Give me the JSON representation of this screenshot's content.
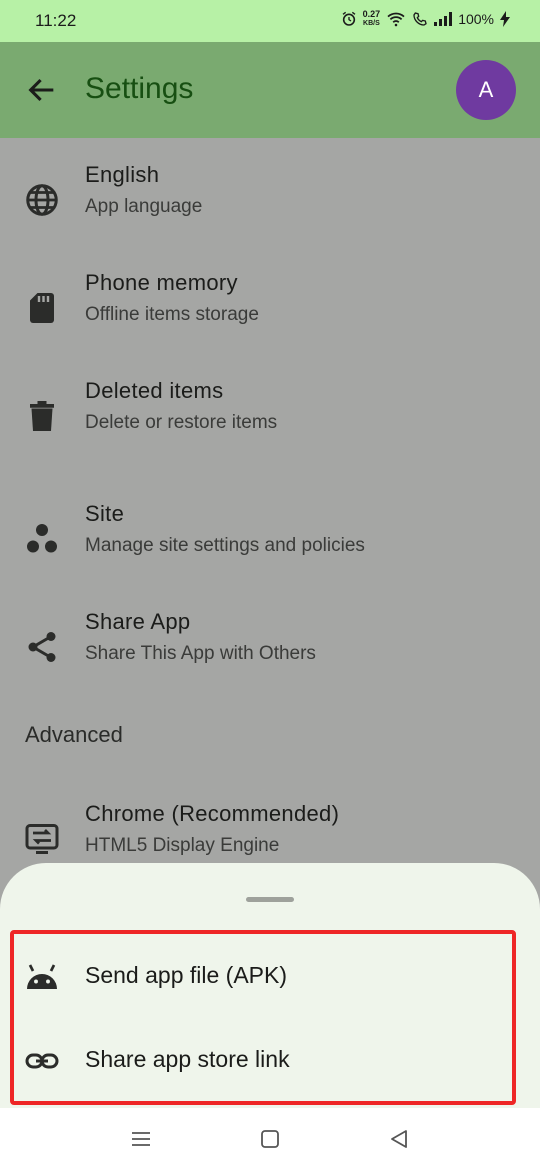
{
  "status_bar": {
    "time": "11:22",
    "speed_value": "0.27",
    "speed_unit": "KB/S",
    "battery": "100%"
  },
  "app_bar": {
    "title": "Settings",
    "avatar_letter": "A"
  },
  "settings": {
    "items": [
      {
        "title": "English",
        "subtitle": "App language",
        "icon": "globe-icon"
      },
      {
        "title": "Phone memory",
        "subtitle": "Offline items storage",
        "icon": "sd-card-icon"
      },
      {
        "title": "Deleted items",
        "subtitle": "Delete or restore items",
        "icon": "trash-icon"
      },
      {
        "title": "Site",
        "subtitle": "Manage site settings and policies",
        "icon": "scatter-dots-icon"
      },
      {
        "title": "Share App",
        "subtitle": "Share This App with Others",
        "icon": "share-icon"
      }
    ],
    "advanced_header": "Advanced",
    "advanced_items": [
      {
        "title": "Chrome (Recommended)",
        "subtitle": "HTML5 Display Engine",
        "icon": "display-engine-icon"
      }
    ]
  },
  "bottom_sheet": {
    "options": [
      {
        "label": "Send app file (APK)",
        "icon": "android-icon"
      },
      {
        "label": "Share app store link",
        "icon": "link-icon"
      }
    ]
  },
  "colors": {
    "status_bar": "#b7f1a6",
    "app_bar": "#7aaa70",
    "title": "#174f12",
    "avatar": "#6f3aa0",
    "scrim_content": "#a5a6a4",
    "sheet": "#eff5eb",
    "highlight": "#ee2626"
  }
}
